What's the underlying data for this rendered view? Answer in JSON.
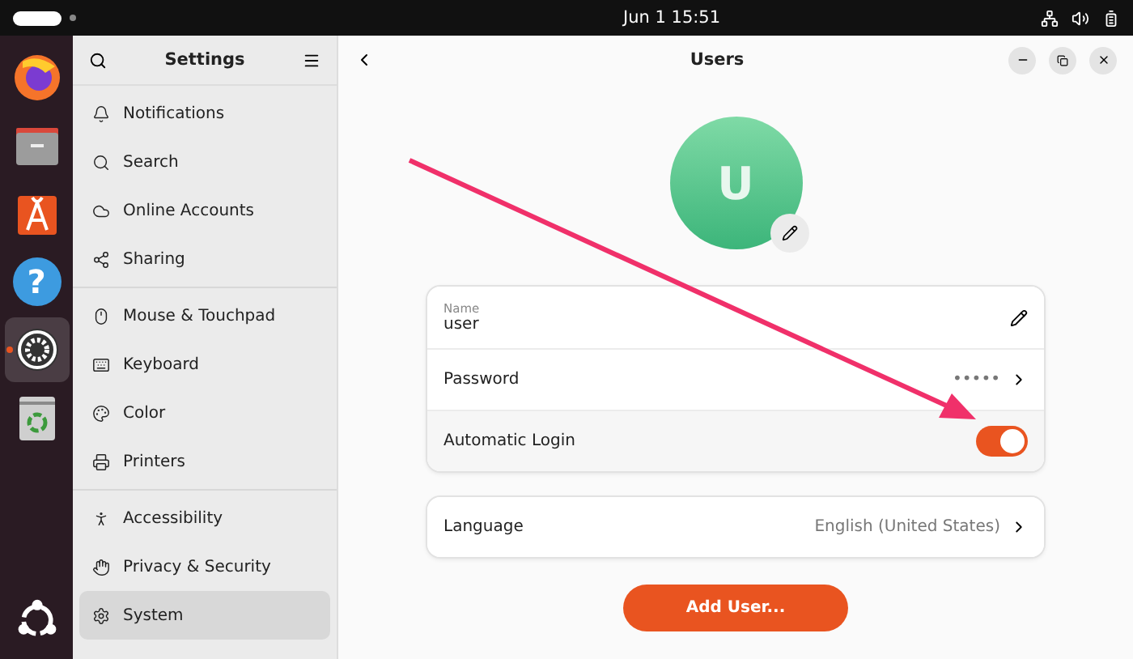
{
  "top_bar": {
    "clock": "Jun 1  15:51"
  },
  "dock": {
    "apps": [
      {
        "selected": false
      },
      {
        "selected": false
      },
      {
        "selected": false
      },
      {
        "selected": false,
        "label": "?"
      },
      {
        "selected": true
      },
      {
        "selected": false
      }
    ]
  },
  "sidebar": {
    "title": "Settings",
    "groups": [
      [
        {
          "label": "Notifications",
          "selected": false
        },
        {
          "label": "Search",
          "selected": false
        },
        {
          "label": "Online Accounts",
          "selected": false
        },
        {
          "label": "Sharing",
          "selected": false
        }
      ],
      [
        {
          "label": "Mouse & Touchpad",
          "selected": false
        },
        {
          "label": "Keyboard",
          "selected": false
        },
        {
          "label": "Color",
          "selected": false
        },
        {
          "label": "Printers",
          "selected": false
        }
      ],
      [
        {
          "label": "Accessibility",
          "selected": false
        },
        {
          "label": "Privacy & Security",
          "selected": false
        },
        {
          "label": "System",
          "selected": true
        }
      ]
    ]
  },
  "page": {
    "title": "Users",
    "avatar": {
      "initial": "U"
    },
    "account": {
      "name_label": "Name",
      "name_value": "user",
      "password_label": "Password",
      "password_value": "•••••",
      "autologin_label": "Automatic Login",
      "autologin_on": true
    },
    "language": {
      "label": "Language",
      "value": "English (United States)"
    },
    "add_button": "Add User..."
  }
}
